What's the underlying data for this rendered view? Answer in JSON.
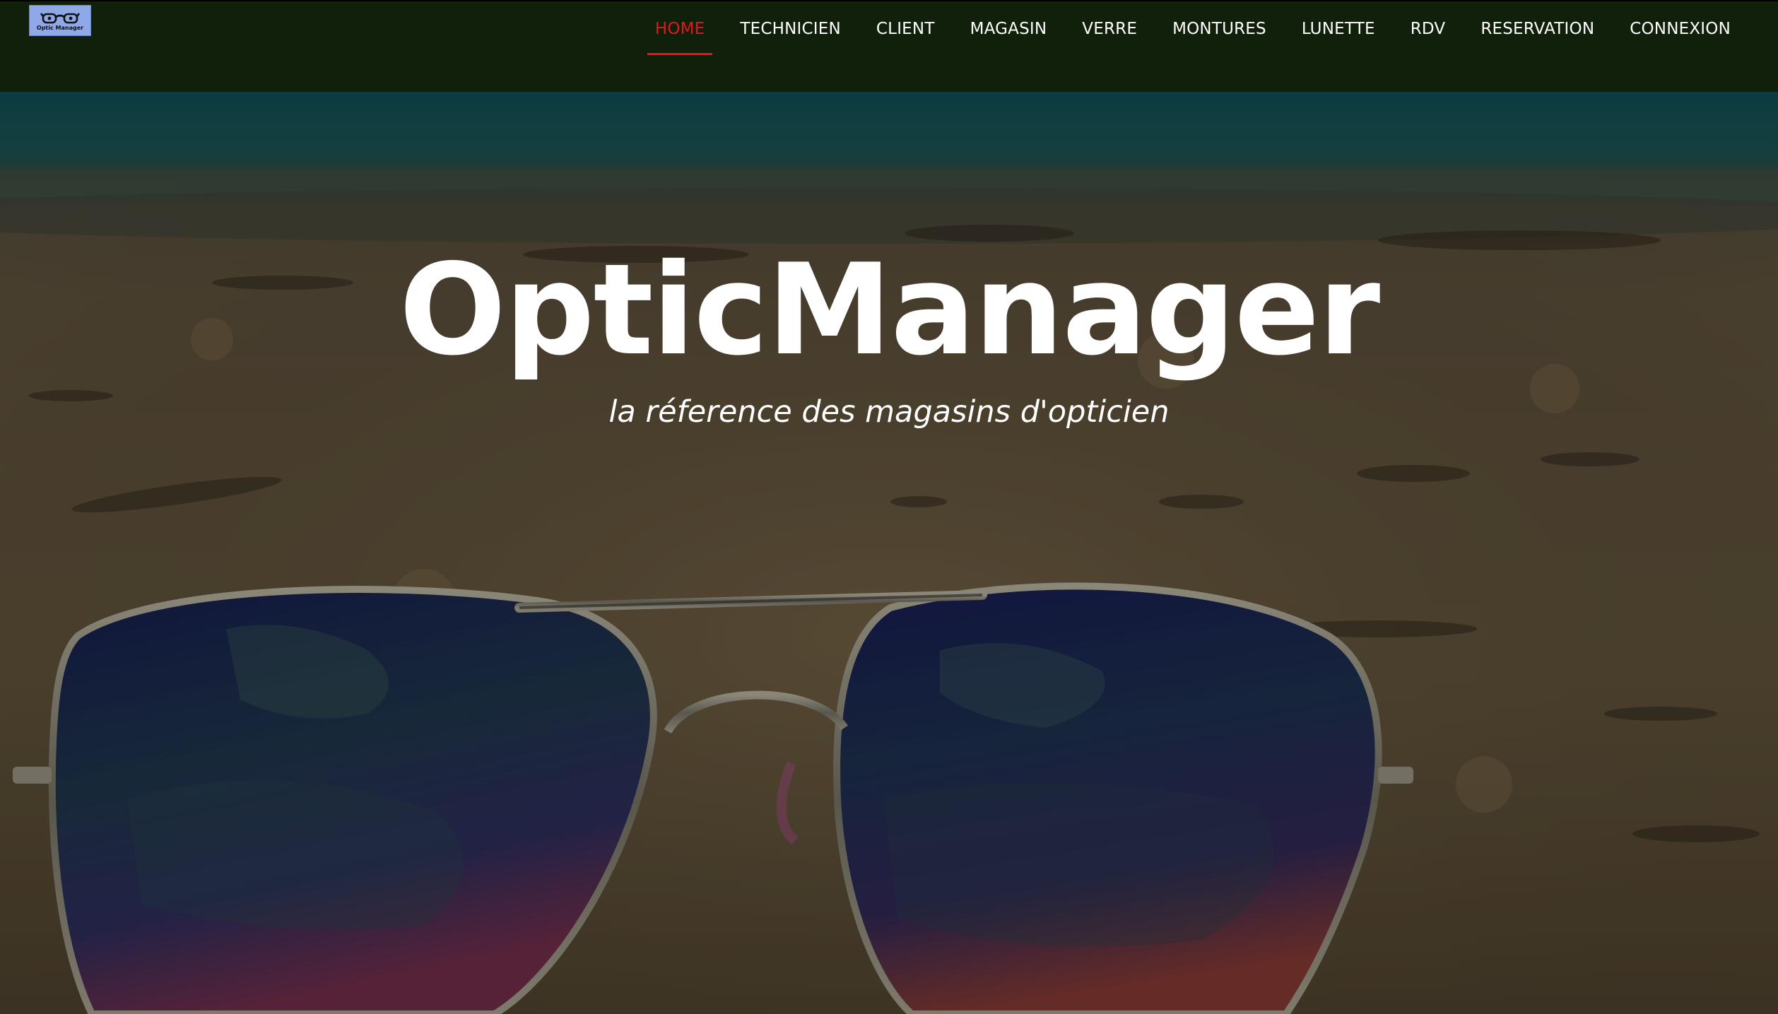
{
  "brand": {
    "logo_text": "Optic Manager",
    "logo_icon": "glasses-icon"
  },
  "nav": {
    "items": [
      {
        "label": "HOME",
        "active": true
      },
      {
        "label": "TECHNICIEN",
        "active": false
      },
      {
        "label": "CLIENT",
        "active": false
      },
      {
        "label": "MAGASIN",
        "active": false
      },
      {
        "label": "VERRE",
        "active": false
      },
      {
        "label": "MONTURES",
        "active": false
      },
      {
        "label": "LUNETTE",
        "active": false
      },
      {
        "label": "RDV",
        "active": false
      },
      {
        "label": "RESERVATION",
        "active": false
      },
      {
        "label": "CONNEXION",
        "active": false
      }
    ]
  },
  "hero": {
    "title": "OpticManager",
    "subtitle": "la réference des magasins d'opticien",
    "background_icon": "sunglasses-on-sand-image"
  },
  "colors": {
    "navbar_bg": "#11200a",
    "active_link": "#e3161b",
    "link": "#ffffff",
    "logo_bg": "#8fa8e8"
  }
}
